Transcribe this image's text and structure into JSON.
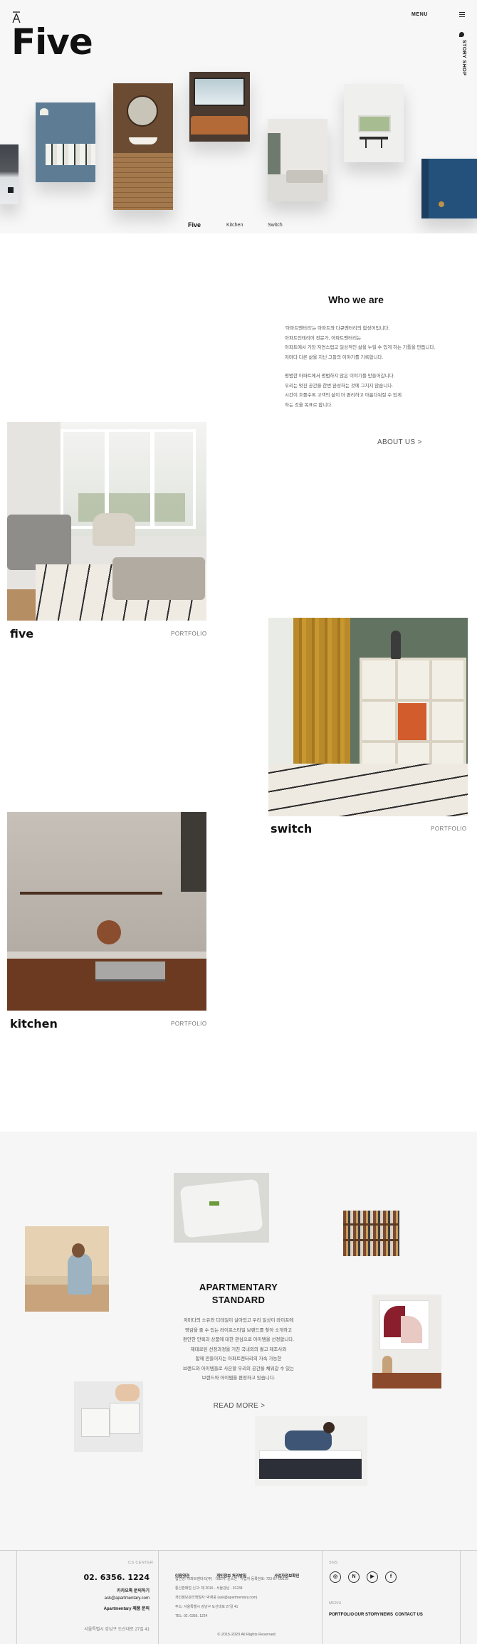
{
  "header": {
    "logo_glyph": "Ā",
    "title": "Five",
    "menu_label": "MENU",
    "side_label": "STORY SHOP"
  },
  "hero_tabs": [
    "Five",
    "Kitchen",
    "Switch"
  ],
  "who": {
    "title": "Who we are",
    "paragraph1": [
      "'아파트멘터리'는 아파트와 다큐멘터리의 합성어입니다.",
      "아파트인테리어 전문가, 아파트멘터리는",
      "아파트에서 가장 자연스럽고 일상적인 삶을 누릴 수 있게 하는 기틀을 만듭니다.",
      "저마다 다른 삶을 지닌 그들의 이야기를 기록합니다."
    ],
    "paragraph2": [
      "평범한 아파트에서 평범하지 않은 이야기를 만들어갑니다.",
      "우리는 멋진 공간을 한번 완성하는 것에 그치지 않습니다.",
      "시간이 흐를수록 고객의 삶이 더 편리하고 아름다워질 수 있게",
      "하는 것을 목표로 합니다."
    ],
    "link": "ABOUT US >"
  },
  "portfolio": [
    {
      "name": "five",
      "tag": "PORTFOLIO"
    },
    {
      "name": "switch",
      "tag": "PORTFOLIO"
    },
    {
      "name": "kitchen",
      "tag": "PORTFOLIO"
    }
  ],
  "standard": {
    "title_line1": "APARTMENTARY",
    "title_line2": "STANDARD",
    "text": [
      "저마다의 소유와 디테일이 살아있고 우리 일상이 라이프에",
      "영감을 줄 수 있는 라이프스타일 브랜드를 찾아 소개하고",
      "편안한 안목과 상품에 대한 관심으로 아이템을 선정합니다.",
      "제대로된 선정과정을 거친 국내외의 퀄고 제조사와",
      "함께 만들어지는 아파트멘터리의 자속 가능한",
      "브랜드와 아이템들로 사은할 우리의 공간을 채워갈 수 있는",
      "브랜드와 아이템을 편정하고 있습니다."
    ],
    "link": "READ MORE >"
  },
  "footer": {
    "cs_label": "CS CENTER",
    "phone": "02. 6356. 1224",
    "kakao": "카카오톡 문의하기",
    "email": "ask@apartmentary.com",
    "product_inquiry": "Apartmentary 제품 문의",
    "address_short": "서울특별시 강남구 도산대로 27길 41",
    "headings": [
      "이용약관",
      "개인정보 처리방침",
      "사업자정보확인"
    ],
    "info": [
      "법인명: 아파트멘터리(주) · 대표자: 윤소연 · 사업자 등록번호: 723-87-00519",
      "통신판매업 신고: 제 2016 - 서울강남 - 01234",
      "개인정보관리책임자: 박재웅 (ask@apartmentary.com)",
      "주소: 서울특별시 강남구 도산대로 27길 41",
      "TEL: 02. 6356. 1224"
    ],
    "copyright": "© 2015-2020 All Rights Reserved",
    "sns_label": "SNS",
    "social_icons": [
      "instagram-icon",
      "naver-icon",
      "youtube-icon",
      "facebook-icon"
    ],
    "menu_label": "MENU",
    "menu": [
      "PORTFOLIO",
      "OUR STORY",
      "NEWS",
      "CONTACT US"
    ]
  }
}
